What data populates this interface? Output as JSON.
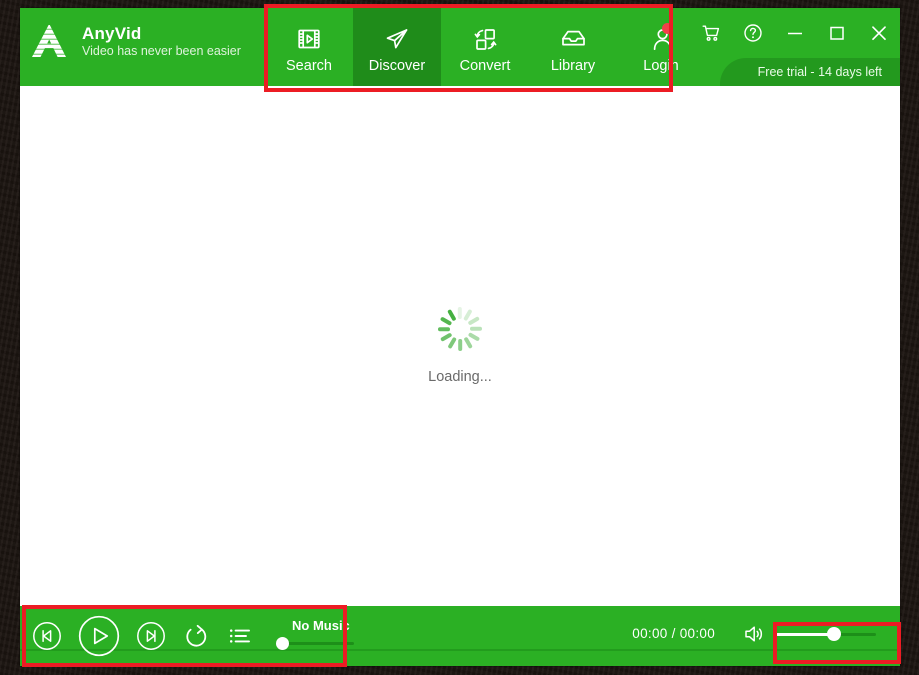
{
  "app": {
    "brand_name": "AnyVid",
    "tagline": "Video has never been easier"
  },
  "nav": {
    "items": [
      {
        "label": "Search",
        "icon": "film-strip-play-icon",
        "active": false,
        "badge": false
      },
      {
        "label": "Discover",
        "icon": "paper-plane-icon",
        "active": true,
        "badge": false
      },
      {
        "label": "Convert",
        "icon": "convert-squares-icon",
        "active": false,
        "badge": false
      },
      {
        "label": "Library",
        "icon": "inbox-tray-icon",
        "active": false,
        "badge": false
      },
      {
        "label": "Login",
        "icon": "user-person-icon",
        "active": false,
        "badge": true
      }
    ]
  },
  "window_controls": {
    "cart": "cart-icon",
    "help": "help-question-icon",
    "minimize": "minimize-icon",
    "maximize": "maximize-icon",
    "close": "close-icon"
  },
  "trial": {
    "text": "Free trial - 14 days left"
  },
  "content": {
    "loading_text": "Loading..."
  },
  "player": {
    "prev_label": "previous-track",
    "play_label": "play",
    "next_label": "next-track",
    "repeat_label": "repeat",
    "playlist_label": "playlist",
    "music_title": "No Music",
    "music_progress_percent": 0,
    "time": "00:00 / 00:00",
    "volume_percent": 58,
    "volume_icon": "speaker-volume-icon"
  },
  "colors": {
    "brand_green": "#2bb024",
    "active_green": "#1f8c1a",
    "trial_green": "#23991e",
    "annotation_red": "#ec1c24",
    "badge_red": "#f2404a",
    "spinner_green": "#45b040"
  }
}
